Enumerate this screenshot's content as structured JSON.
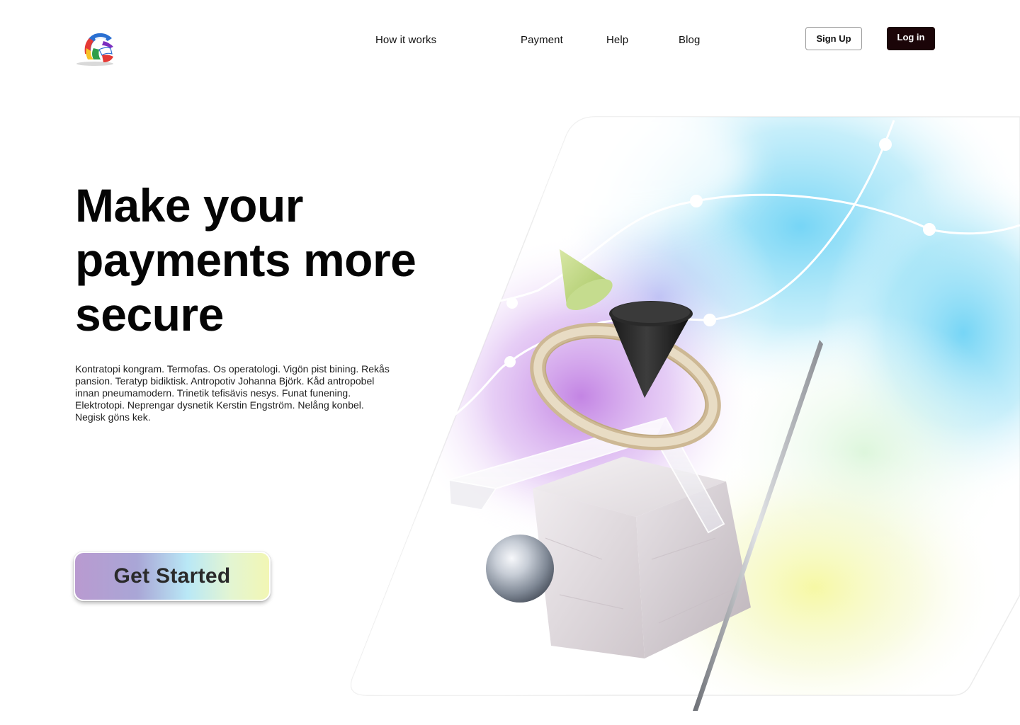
{
  "header": {
    "logo_icon": "colorful-globe-logo-icon",
    "nav": [
      {
        "label": "How it works"
      },
      {
        "label": "Payment"
      },
      {
        "label": "Help"
      },
      {
        "label": "Blog"
      }
    ],
    "signup_label": "Sign Up",
    "login_label": "Log in"
  },
  "hero": {
    "title_lines": [
      "Make your",
      "payments more",
      "secure"
    ],
    "description": "Kontratopi kongram. Termofas. Os operatologi. Vigön pist bining. Rekås pansion. Teratyp bidiktisk. Antropotiv Johanna Björk. Kåd antropobel innan pneumamodern. Trinetik tefisävis nesys. Funat funening. Elektrotopi. Neprengar dysnetik Kerstin Engström. Nelång konbel. Negisk göns kek.",
    "cta_label": "Get Started"
  },
  "colors": {
    "login_bg": "#1b0508",
    "cta_gradient": [
      "#b99ad0",
      "#b9e8f6",
      "#f2f6b4"
    ],
    "art_cyan": "#7fd8f2",
    "art_purple": "#c99be6",
    "art_yellow": "#f6f8a8"
  }
}
